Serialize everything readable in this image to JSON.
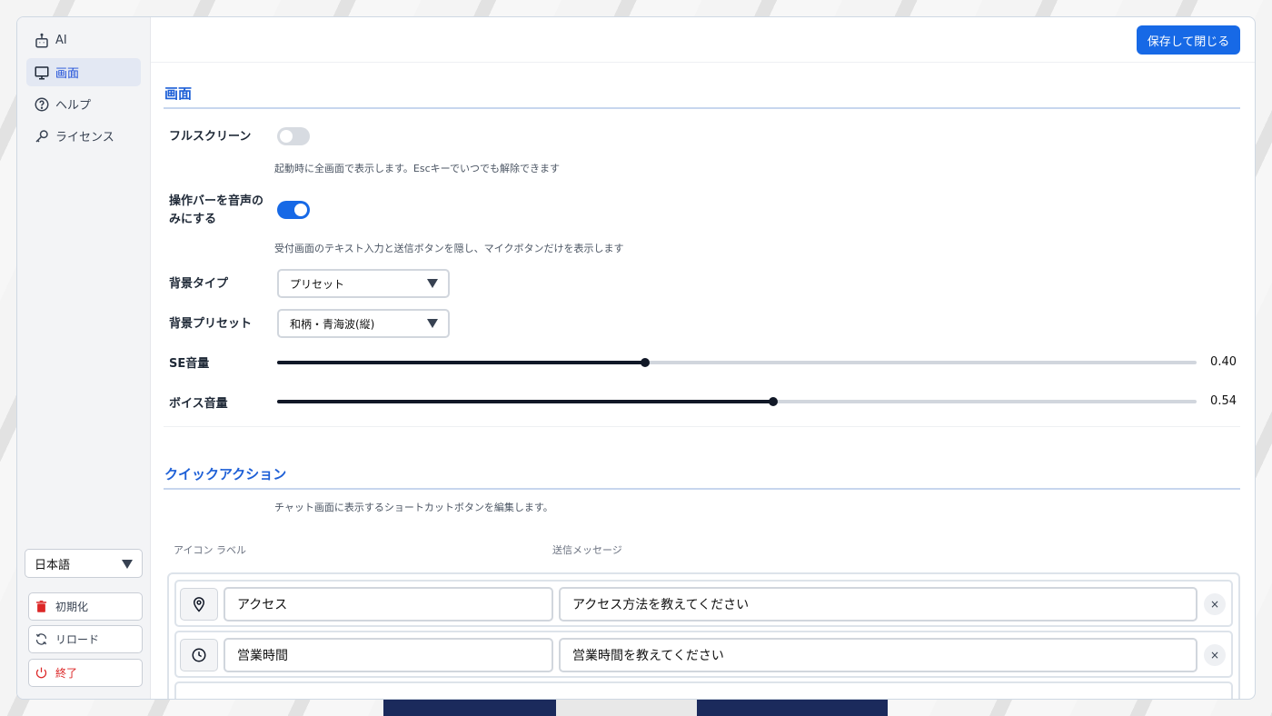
{
  "sidebar": {
    "items": [
      {
        "label": "AI",
        "icon": "robot-icon"
      },
      {
        "label": "画面",
        "icon": "monitor-icon"
      },
      {
        "label": "ヘルプ",
        "icon": "help-circle-icon"
      },
      {
        "label": "ライセンス",
        "icon": "key-icon"
      }
    ],
    "active_index": 1,
    "language": "日本語",
    "buttons": {
      "reset": "初期化",
      "reload": "リロード",
      "exit": "終了"
    }
  },
  "header": {
    "save_label": "保存して閉じる"
  },
  "display": {
    "title": "画面",
    "fullscreen": {
      "label": "フルスクリーン",
      "enabled": false,
      "help": "起動時に全画面で表示します。Escキーでいつでも解除できます"
    },
    "voice_only": {
      "label_line1": "操作バーを音声の",
      "label_line2": "みにする",
      "enabled": true,
      "help": "受付画面のテキスト入力と送信ボタンを隠し、マイクボタンだけを表示します"
    },
    "bg_type": {
      "label": "背景タイプ",
      "value": "プリセット"
    },
    "bg_preset": {
      "label": "背景プリセット",
      "value": "和柄・青海波(縦)"
    },
    "se_volume": {
      "label": "SE音量",
      "value": 0.4,
      "display": "0.40"
    },
    "voice_volume": {
      "label": "ボイス音量",
      "value": 0.54,
      "display": "0.54"
    }
  },
  "quick_actions": {
    "title": "クイックアクション",
    "description": "チャット画面に表示するショートカットボタンを編集します。",
    "col_icon_label": "アイコン ラベル",
    "col_message": "送信メッセージ",
    "rows": [
      {
        "icon": "map-pin-icon",
        "label": "アクセス",
        "message": "アクセス方法を教えてください"
      },
      {
        "icon": "clock-icon",
        "label": "営業時間",
        "message": "営業時間を教えてください"
      }
    ],
    "delete_symbol": "×"
  },
  "colors": {
    "accent": "#1769e6",
    "section_title": "#1d5fd6",
    "danger": "#dc2626"
  }
}
